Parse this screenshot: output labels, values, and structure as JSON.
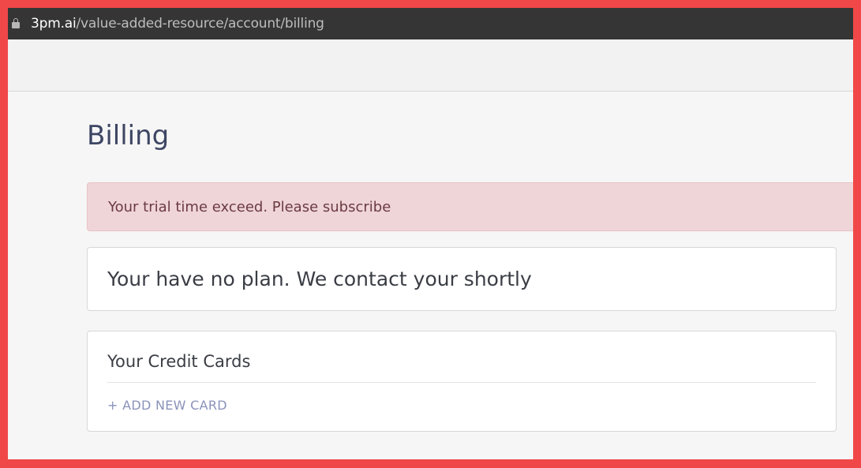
{
  "browser": {
    "url_domain": "3pm.ai",
    "url_path": "/value-added-resource/account/billing"
  },
  "page": {
    "title": "Billing"
  },
  "alert": {
    "message": "Your trial time exceed. Please subscribe"
  },
  "plan": {
    "message": "Your have no plan. We contact your shortly"
  },
  "credit_cards": {
    "title": "Your Credit Cards",
    "add_label": "+ ADD NEW CARD"
  },
  "colors": {
    "frame_border": "#f04848",
    "url_bar": "#353535",
    "title": "#3d4663",
    "alert_bg": "#efd5d8",
    "link": "#8a93ba"
  }
}
